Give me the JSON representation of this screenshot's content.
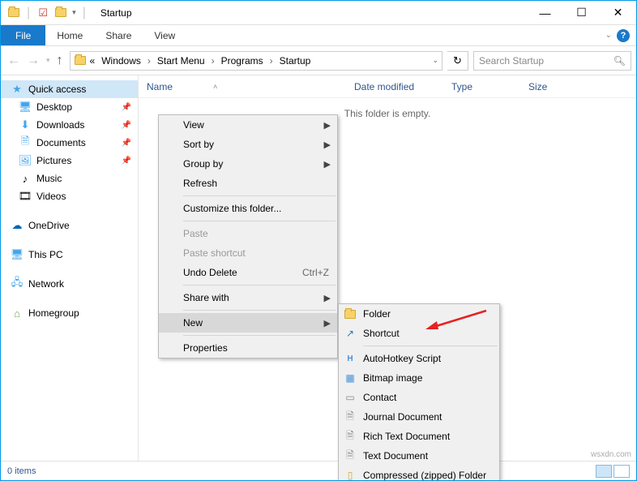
{
  "titlebar": {
    "title": "Startup"
  },
  "menubar": {
    "file": "File",
    "home": "Home",
    "share": "Share",
    "view": "View"
  },
  "breadcrumbs": [
    "Windows",
    "Start Menu",
    "Programs",
    "Startup"
  ],
  "search": {
    "placeholder": "Search Startup"
  },
  "sidebar": {
    "quick_access": "Quick access",
    "items": [
      {
        "label": "Desktop",
        "pinned": true
      },
      {
        "label": "Downloads",
        "pinned": true
      },
      {
        "label": "Documents",
        "pinned": true
      },
      {
        "label": "Pictures",
        "pinned": true
      },
      {
        "label": "Music",
        "pinned": false
      },
      {
        "label": "Videos",
        "pinned": false
      }
    ],
    "onedrive": "OneDrive",
    "thispc": "This PC",
    "network": "Network",
    "homegroup": "Homegroup"
  },
  "columns": {
    "name": "Name",
    "date": "Date modified",
    "type": "Type",
    "size": "Size"
  },
  "main": {
    "empty": "This folder is empty."
  },
  "status": {
    "items": "0 items"
  },
  "context_menu": {
    "view": "View",
    "sort_by": "Sort by",
    "group_by": "Group by",
    "refresh": "Refresh",
    "customize": "Customize this folder...",
    "paste": "Paste",
    "paste_shortcut": "Paste shortcut",
    "undo_delete": "Undo Delete",
    "undo_key": "Ctrl+Z",
    "share_with": "Share with",
    "new": "New",
    "properties": "Properties"
  },
  "submenu": {
    "folder": "Folder",
    "shortcut": "Shortcut",
    "ahk": "AutoHotkey Script",
    "bitmap": "Bitmap image",
    "contact": "Contact",
    "journal": "Journal Document",
    "rtf": "Rich Text Document",
    "text": "Text Document",
    "zip": "Compressed (zipped) Folder"
  },
  "watermark": "wsxdn.com"
}
